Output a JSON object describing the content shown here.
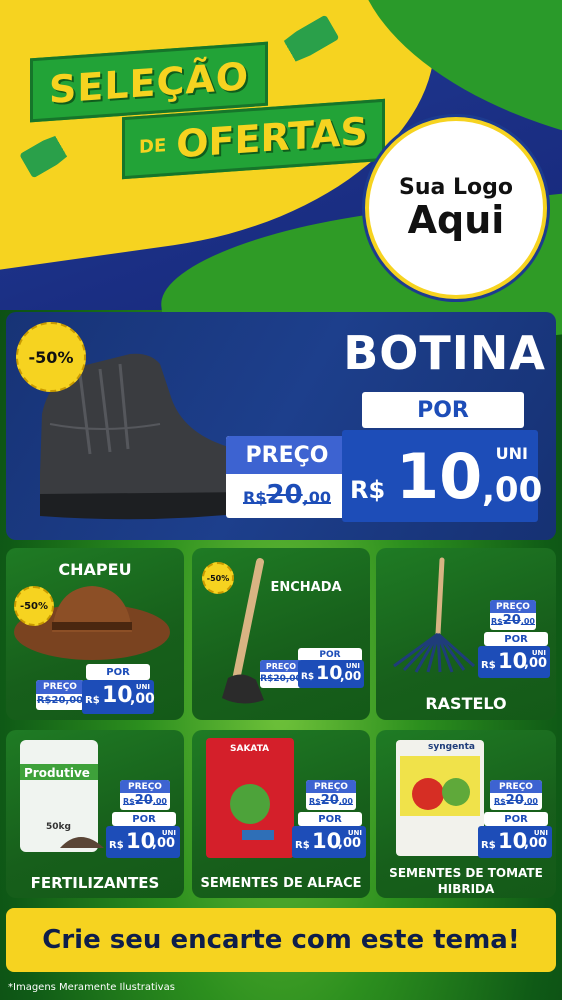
{
  "header": {
    "title_line1": "SELEÇÃO",
    "title_de": "DE",
    "title_line2": "OFERTAS",
    "logo_line1": "Sua Logo",
    "logo_line2": "Aqui"
  },
  "hero": {
    "product": "BOTINA",
    "discount": "-50%",
    "por_label": "POR",
    "preco_label": "PREÇO",
    "old_currency": "R$",
    "old_int": "20",
    "old_cents": ",00",
    "currency": "R$",
    "price_int": "10",
    "price_cents": ",00",
    "unit": "UNI"
  },
  "cards": [
    {
      "name": "CHAPEU",
      "discount": "-50%",
      "preco_label": "PREÇO",
      "old_price": "R$20,00",
      "por_label": "POR",
      "currency": "R$",
      "price_int": "10",
      "price_cents": ",00",
      "unit": "UNI"
    },
    {
      "name": "ENCHADA",
      "discount": "-50%",
      "preco_label": "PREÇO",
      "old_price": "R$20,00",
      "por_label": "POR",
      "currency": "R$",
      "price_int": "10",
      "price_cents": ",00",
      "unit": "UNI"
    },
    {
      "name": "RASTELO",
      "preco_label": "PREÇO",
      "old_currency": "R$",
      "old_int": "20",
      "old_cents": ",00",
      "por_label": "POR",
      "currency": "R$",
      "price_int": "10",
      "price_cents": ",00",
      "unit": "UNI"
    },
    {
      "name": "FERTILIZANTES",
      "preco_label": "PREÇO",
      "old_currency": "R$",
      "old_int": "20",
      "old_cents": ",00",
      "por_label": "POR",
      "currency": "R$",
      "price_int": "10",
      "price_cents": ",00",
      "unit": "UNI",
      "bag_brand": "Produtive",
      "bag_weight": "50kg"
    },
    {
      "name": "SEMENTES DE ALFACE",
      "preco_label": "PREÇO",
      "old_currency": "R$",
      "old_int": "20",
      "old_cents": ",00",
      "por_label": "POR",
      "currency": "R$",
      "price_int": "10",
      "price_cents": ",00",
      "unit": "UNI",
      "pack_brand": "SAKATA"
    },
    {
      "name_line1": "SEMENTES DE TOMATE",
      "name_line2": "HIBRIDA",
      "preco_label": "PREÇO",
      "old_currency": "R$",
      "old_int": "20",
      "old_cents": ",00",
      "por_label": "POR",
      "currency": "R$",
      "price_int": "10",
      "price_cents": ",00",
      "unit": "UNI",
      "pack_brand": "syngenta"
    }
  ],
  "banner": {
    "text": "Crie seu encarte com este tema!"
  },
  "footnote": "*Imagens Meramente Ilustrativas",
  "colors": {
    "yellow": "#f6d320",
    "blue": "#1d4db8",
    "green": "#22a337",
    "navy": "#173376"
  }
}
